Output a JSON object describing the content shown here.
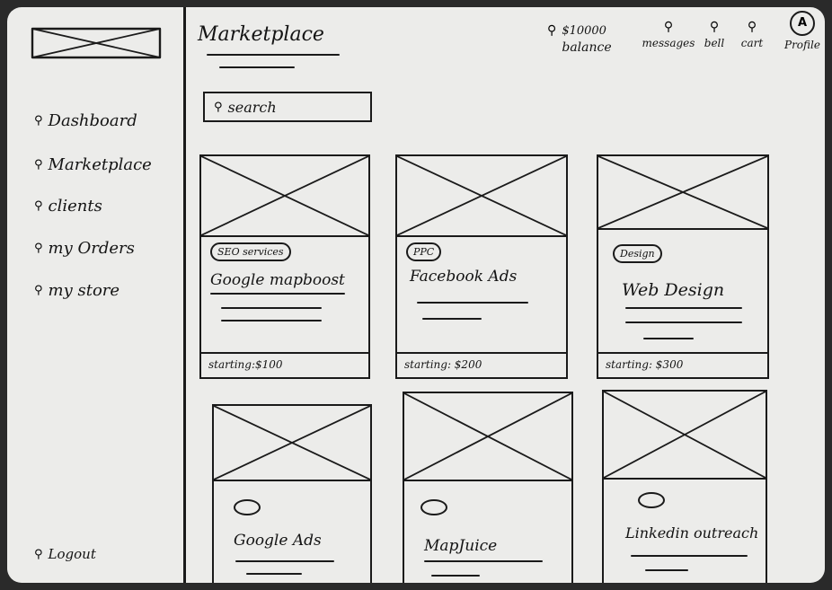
{
  "app": {
    "title": "Marketplace"
  },
  "sidebar": {
    "items": [
      {
        "label": "Dashboard",
        "icon": "dashboard-icon"
      },
      {
        "label": "Marketplace",
        "icon": "marketplace-icon"
      },
      {
        "label": "clients",
        "icon": "clients-icon"
      },
      {
        "label": "my Orders",
        "icon": "orders-icon"
      },
      {
        "label": "my store",
        "icon": "store-icon"
      }
    ],
    "logout": {
      "label": "Logout",
      "icon": "logout-icon"
    }
  },
  "search": {
    "label": "search",
    "icon": "search-icon"
  },
  "header": {
    "balance": {
      "amount": "$10000",
      "label": "balance",
      "icon": "wallet-icon"
    },
    "messages": {
      "label": "messages",
      "icon": "messages-icon"
    },
    "bell": {
      "label": "bell",
      "icon": "bell-icon"
    },
    "cart": {
      "label": "cart",
      "icon": "cart-icon"
    },
    "profile": {
      "label": "Profile",
      "icon": "profile-icon",
      "initial": "A"
    }
  },
  "cards": [
    {
      "tag": "SEO services",
      "title": "Google mapboost",
      "price": "starting:$100"
    },
    {
      "tag": "PPC",
      "title": "Facebook Ads",
      "price": "starting: $200"
    },
    {
      "tag": "Design",
      "title": "Web Design",
      "price": "starting: $300"
    },
    {
      "tag": "",
      "title": "Google Ads",
      "price": ""
    },
    {
      "tag": "",
      "title": "MapJuice",
      "price": ""
    },
    {
      "tag": "",
      "title": "Linkedin outreach",
      "price": ""
    }
  ]
}
